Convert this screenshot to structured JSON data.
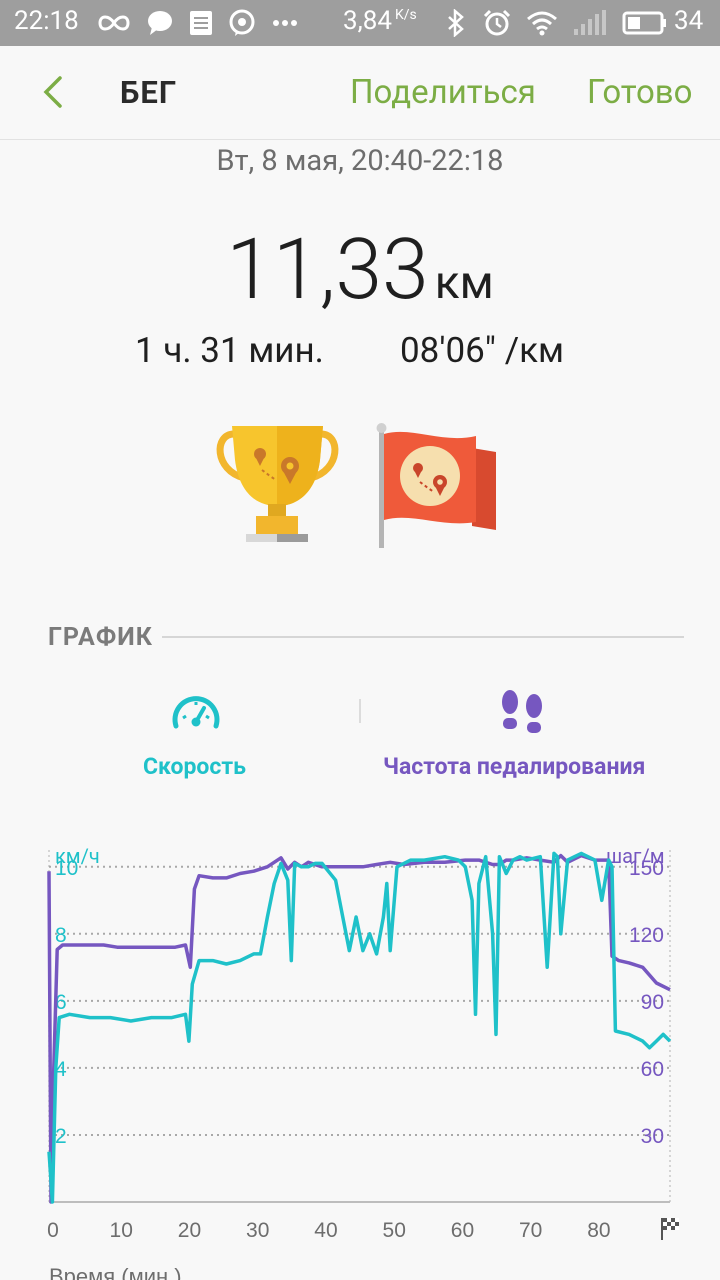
{
  "status_bar": {
    "time": "22:18",
    "net_speed": "3,84",
    "net_speed_unit": "K/s",
    "battery_percent": "34"
  },
  "header": {
    "title": "БЕГ",
    "share_label": "Поделиться",
    "done_label": "Готово"
  },
  "workout": {
    "datetime": "Вт, 8 мая, 20:40-22:18",
    "distance": "11,33",
    "distance_unit": "км",
    "duration": "1 ч. 31 мин.",
    "pace": "08'06\" /км"
  },
  "achievements": [
    "trophy-icon",
    "flag-icon"
  ],
  "graph_section": {
    "label": "ГРАФИК",
    "tabs": [
      {
        "label": "Скорость",
        "icon": "speedometer-icon",
        "color": "#1fc1c9"
      },
      {
        "label": "Частота педалирования",
        "icon": "footsteps-icon",
        "color": "#7657c0"
      }
    ]
  },
  "colors": {
    "accent_green": "#7cad45",
    "speed": "#1fc1c9",
    "cadence": "#7657c0"
  },
  "chart_data": {
    "type": "line",
    "xlabel": "Время (мин.)",
    "x_ticks": [
      "0",
      "10",
      "20",
      "30",
      "40",
      "50",
      "60",
      "70",
      "80"
    ],
    "xlim": [
      0,
      91
    ],
    "y_left": {
      "label": "км/ч",
      "ticks": [
        "2",
        "4",
        "6",
        "8",
        "10"
      ],
      "lim": [
        0,
        10.5
      ]
    },
    "y_right": {
      "label": "шаг/м",
      "ticks": [
        "30",
        "60",
        "90",
        "120",
        "150"
      ],
      "lim": [
        0,
        157.5
      ]
    },
    "grid": true,
    "series": [
      {
        "axis": "right",
        "color": "#7657c0",
        "x": [
          0,
          0.3,
          0.7,
          1.2,
          2,
          5,
          8,
          10,
          13,
          16,
          18.5,
          20,
          20.7,
          21.3,
          22,
          24,
          26,
          28,
          30,
          32,
          33,
          34,
          35,
          36,
          37,
          38,
          40,
          43,
          46,
          48,
          50,
          52,
          55,
          58,
          61,
          63,
          65,
          66,
          67,
          68,
          70,
          72,
          74,
          75,
          76,
          78,
          80,
          82,
          82.5,
          83.5,
          85,
          87,
          89,
          91
        ],
        "y": [
          148,
          0,
          60,
          113,
          115,
          115,
          115,
          114,
          114,
          114,
          114,
          115,
          105,
          140,
          146,
          145,
          145,
          147,
          148,
          150,
          152,
          154,
          149,
          152,
          150,
          152,
          150,
          150,
          150,
          151,
          152,
          151,
          152,
          152,
          153,
          153,
          151,
          151,
          153,
          153,
          154,
          153,
          152,
          155,
          152,
          155,
          153,
          153,
          110,
          108,
          107,
          105,
          98,
          95
        ]
      },
      {
        "axis": "left",
        "color": "#1fc1c9",
        "x": [
          0,
          0.5,
          1,
          1.5,
          3,
          6,
          9,
          12,
          15,
          18,
          20,
          20.5,
          21,
          22,
          24,
          26,
          28,
          30,
          31,
          32,
          33,
          34,
          35,
          35.5,
          36,
          37,
          38,
          39,
          40,
          42,
          44,
          45,
          46,
          47,
          48,
          49,
          49.5,
          50,
          51,
          52,
          53,
          55,
          58,
          60,
          61,
          62,
          62.5,
          63,
          64,
          65,
          65.5,
          66,
          67,
          68,
          69,
          70,
          72,
          73,
          74,
          74.5,
          75,
          76,
          77,
          78,
          80,
          81,
          82,
          82.5,
          83,
          85,
          87,
          88,
          89,
          90,
          91
        ],
        "y": [
          1.5,
          0,
          4,
          5.5,
          5.6,
          5.5,
          5.5,
          5.4,
          5.5,
          5.5,
          5.6,
          4.8,
          6.5,
          7.2,
          7.2,
          7.1,
          7.2,
          7.4,
          7.4,
          8.5,
          9.5,
          10.1,
          9.6,
          7.2,
          10.1,
          10,
          10,
          10.1,
          10.1,
          9.6,
          7.5,
          8.5,
          7.5,
          8,
          7.4,
          8.5,
          9.5,
          7.5,
          10,
          10.1,
          10.2,
          10.2,
          10.3,
          10.2,
          10,
          9,
          5.6,
          9.5,
          10.3,
          8,
          5,
          10.3,
          9.8,
          10.2,
          10.3,
          10.2,
          10.3,
          7,
          10.4,
          10.3,
          8,
          10.2,
          10.3,
          10.4,
          10.2,
          9,
          10.2,
          10,
          5.1,
          5,
          4.8,
          4.6,
          4.8,
          5,
          4.8
        ]
      }
    ]
  }
}
